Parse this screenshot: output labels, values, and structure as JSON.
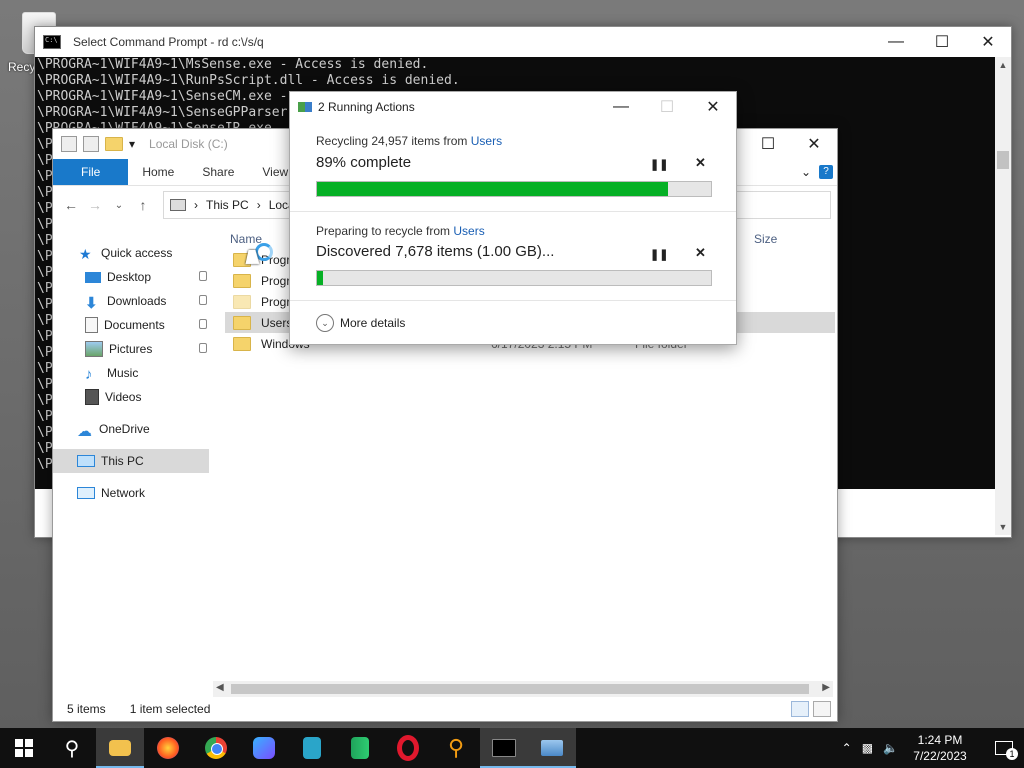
{
  "desktop": {
    "recycle_bin_label": "Recy"
  },
  "cmd": {
    "title": "Select Command Prompt - rd  c:\\/s/q",
    "lines": [
      "\\PROGRA~1\\WIF4A9~1\\MsSense.exe - Access is denied.",
      "\\PROGRA~1\\WIF4A9~1\\RunPsScript.dll - Access is denied.",
      "\\PROGRA~1\\WIF4A9~1\\SenseCM.exe -",
      "\\PROGRA~1\\WIF4A9~1\\SenseGPParser",
      "\\PROGRA~1\\WIF4A9~1\\SenseIR.exe",
      "\\P",
      "\\P",
      "\\P",
      "\\P",
      "\\P",
      "\\P",
      "\\P",
      "\\P",
      "\\P",
      "\\P",
      "\\P",
      "\\P",
      "\\P",
      "\\P",
      "\\P",
      "\\P",
      "\\P",
      "\\P",
      "\\P",
      "\\P",
      "\\P"
    ]
  },
  "explorer": {
    "title": "Local Disk (C:)",
    "ribbon_tabs": [
      "File",
      "Home",
      "Share",
      "View"
    ],
    "address": {
      "segments": [
        "This PC",
        "Local"
      ]
    },
    "sidebar": {
      "items": [
        {
          "label": "Quick access"
        },
        {
          "label": "Desktop"
        },
        {
          "label": "Downloads"
        },
        {
          "label": "Documents"
        },
        {
          "label": "Pictures"
        },
        {
          "label": "Music"
        },
        {
          "label": "Videos"
        },
        {
          "label": "OneDrive"
        },
        {
          "label": "This PC"
        },
        {
          "label": "Network"
        }
      ]
    },
    "columns": {
      "name": "Name",
      "size": "Size"
    },
    "files": [
      {
        "name": "Program",
        "date": "",
        "type": ""
      },
      {
        "name": "Program",
        "date": "",
        "type": ""
      },
      {
        "name": "Program",
        "date": "",
        "type": ""
      },
      {
        "name": "Users",
        "date": "",
        "type": ""
      },
      {
        "name": "Windows",
        "date": "6/17/2023 2:15 PM",
        "type": "File folder"
      }
    ],
    "status": {
      "items": "5 items",
      "selected": "1 item selected"
    }
  },
  "dialog": {
    "title": "2 Running Actions",
    "action1": {
      "desc_prefix": "Recycling 24,957 items from ",
      "desc_link": "Users",
      "status": "89% complete",
      "progress": 0.89
    },
    "action2": {
      "desc_prefix": "Preparing to recycle from ",
      "desc_link": "Users",
      "status": "Discovered 7,678 items (1.00 GB)...",
      "progress": 0.015
    },
    "more_details": "More details"
  },
  "taskbar": {
    "apps": [
      "start",
      "search",
      "file-explorer",
      "firefox",
      "chrome",
      "bing",
      "visual-studio-preview",
      "vs-code",
      "opera",
      "search-tool",
      "command-prompt",
      "network-app"
    ],
    "clock_time": "1:24 PM",
    "clock_date": "7/22/2023",
    "notification_count": "1"
  }
}
